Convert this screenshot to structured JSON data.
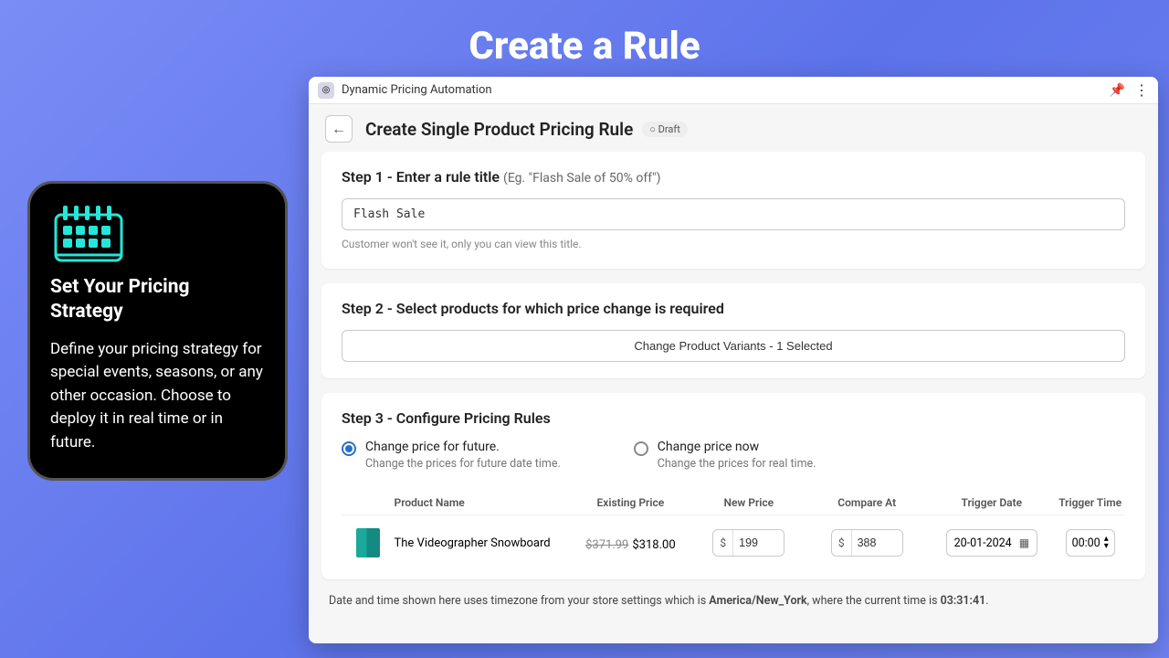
{
  "hero_title": "Create a Rule",
  "side": {
    "heading": "Set Your Pricing Strategy",
    "body": "Define your pricing strategy for special events, seasons, or any other occasion. Choose to deploy it in real time or in future."
  },
  "app": {
    "name": "Dynamic Pricing Automation",
    "page_title": "Create Single Product Pricing Rule",
    "draft_label": "○ Draft"
  },
  "step1": {
    "title": "Step 1 - Enter a rule title",
    "example": "(Eg. \"Flash Sale of 50% off\")",
    "value": "Flash Sale",
    "helper": "Customer won't see it, only you can view this title."
  },
  "step2": {
    "title": "Step 2 - Select products for which price change is required",
    "button": "Change Product Variants - 1 Selected"
  },
  "step3": {
    "title": "Step 3 - Configure Pricing Rules",
    "options": [
      {
        "label": "Change price for future.",
        "sub": "Change the prices for future date time.",
        "selected": true
      },
      {
        "label": "Change price now",
        "sub": "Change the prices for real time.",
        "selected": false
      }
    ],
    "columns": {
      "name": "Product Name",
      "existing": "Existing Price",
      "newp": "New Price",
      "compare": "Compare At",
      "trigdate": "Trigger Date",
      "trigtime": "Trigger Time"
    },
    "row": {
      "name": "The Videographer Snowboard",
      "old_price": "$371.99",
      "cur_price": "$318.00",
      "new_price": "199",
      "compare_at": "388",
      "trigger_date": "20-01-2024",
      "trigger_time": "00:00"
    }
  },
  "tz": {
    "prefix": "Date and time shown here uses timezone from your store settings which is ",
    "zone": "America/New_York",
    "mid": ", where the current time is ",
    "time": "03:31:41",
    "suffix": "."
  },
  "currency_symbol": "$"
}
